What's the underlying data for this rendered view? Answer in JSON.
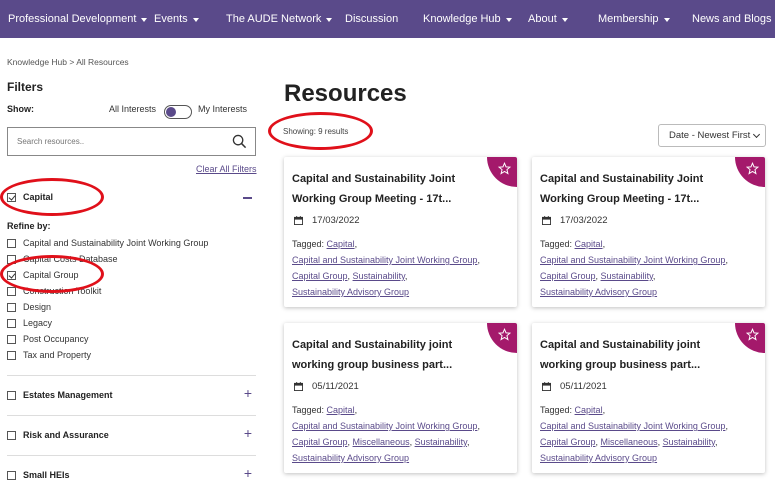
{
  "nav": {
    "items": [
      {
        "label": "Professional Development",
        "caret": true
      },
      {
        "label": "Events",
        "caret": true
      },
      {
        "label": "The AUDE Network",
        "caret": true
      },
      {
        "label": "Discussion",
        "caret": false
      },
      {
        "label": "Knowledge Hub",
        "caret": true
      },
      {
        "label": "About",
        "caret": true
      },
      {
        "label": "Membership",
        "caret": true
      },
      {
        "label": "News and Blogs",
        "caret": true
      }
    ]
  },
  "breadcrumb": "Knowledge Hub > All Resources",
  "filters": {
    "title": "Filters",
    "show_label": "Show:",
    "all_interests": "All Interests",
    "my_interests": "My Interests",
    "search_placeholder": "Search resources..",
    "clear_all": "Clear All Filters",
    "refine_label": "Refine by:",
    "categories": [
      {
        "label": "Capital",
        "checked": true,
        "expanded": true
      },
      {
        "label": "Estates Management",
        "checked": false,
        "expanded": false
      },
      {
        "label": "Risk and Assurance",
        "checked": false,
        "expanded": false
      },
      {
        "label": "Small HEIs",
        "checked": false,
        "expanded": false
      }
    ],
    "subitems": [
      {
        "label": "Capital and Sustainability Joint Working Group",
        "checked": false
      },
      {
        "label": "Capital Costs Database",
        "checked": false
      },
      {
        "label": "Capital Group",
        "checked": true
      },
      {
        "label": "Construction Toolkit",
        "checked": false
      },
      {
        "label": "Design",
        "checked": false
      },
      {
        "label": "Legacy",
        "checked": false
      },
      {
        "label": "Post Occupancy",
        "checked": false
      },
      {
        "label": "Tax and Property",
        "checked": false
      }
    ]
  },
  "main": {
    "title": "Resources",
    "showing": "Showing: 9 results",
    "sort_value": "Date - Newest First",
    "tagged_label": "Tagged:",
    "cards": [
      {
        "title": "Capital and Sustainability Joint Working Group Meeting - 17t...",
        "date": "17/03/2022",
        "tags": [
          "Capital",
          "Capital and Sustainability Joint Working Group",
          "Capital Group",
          "Sustainability",
          "Sustainability Advisory Group"
        ]
      },
      {
        "title": "Capital and Sustainability Joint Working Group Meeting - 17t...",
        "date": "17/03/2022",
        "tags": [
          "Capital",
          "Capital and Sustainability Joint Working Group",
          "Capital Group",
          "Sustainability",
          "Sustainability Advisory Group"
        ]
      },
      {
        "title": "Capital and Sustainability joint working group business part...",
        "date": "05/11/2021",
        "tags": [
          "Capital",
          "Capital and Sustainability Joint Working Group",
          "Capital Group",
          "Miscellaneous",
          "Sustainability",
          "Sustainability Advisory Group"
        ]
      },
      {
        "title": "Capital and Sustainability joint working group business part...",
        "date": "05/11/2021",
        "tags": [
          "Capital",
          "Capital and Sustainability Joint Working Group",
          "Capital Group",
          "Miscellaneous",
          "Sustainability",
          "Sustainability Advisory Group"
        ]
      }
    ]
  },
  "colors": {
    "nav_bg": "#5a4a8a",
    "accent": "#5a4a8a",
    "card_corner": "#a4196b",
    "annotation": "#e0101a"
  }
}
